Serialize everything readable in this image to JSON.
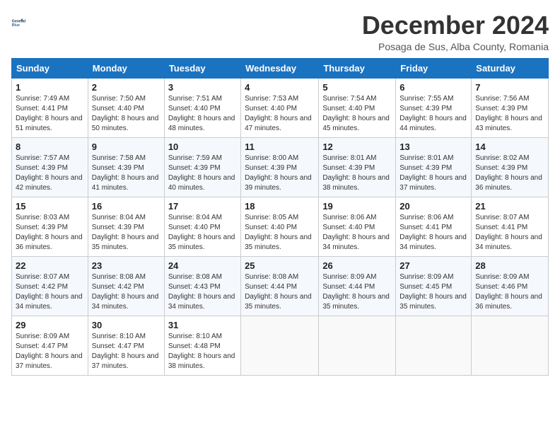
{
  "logo": {
    "line1": "General",
    "line2": "Blue"
  },
  "title": "December 2024",
  "subtitle": "Posaga de Sus, Alba County, Romania",
  "days_of_week": [
    "Sunday",
    "Monday",
    "Tuesday",
    "Wednesday",
    "Thursday",
    "Friday",
    "Saturday"
  ],
  "weeks": [
    [
      {
        "day": "1",
        "sunrise": "Sunrise: 7:49 AM",
        "sunset": "Sunset: 4:41 PM",
        "daylight": "Daylight: 8 hours and 51 minutes."
      },
      {
        "day": "2",
        "sunrise": "Sunrise: 7:50 AM",
        "sunset": "Sunset: 4:40 PM",
        "daylight": "Daylight: 8 hours and 50 minutes."
      },
      {
        "day": "3",
        "sunrise": "Sunrise: 7:51 AM",
        "sunset": "Sunset: 4:40 PM",
        "daylight": "Daylight: 8 hours and 48 minutes."
      },
      {
        "day": "4",
        "sunrise": "Sunrise: 7:53 AM",
        "sunset": "Sunset: 4:40 PM",
        "daylight": "Daylight: 8 hours and 47 minutes."
      },
      {
        "day": "5",
        "sunrise": "Sunrise: 7:54 AM",
        "sunset": "Sunset: 4:40 PM",
        "daylight": "Daylight: 8 hours and 45 minutes."
      },
      {
        "day": "6",
        "sunrise": "Sunrise: 7:55 AM",
        "sunset": "Sunset: 4:39 PM",
        "daylight": "Daylight: 8 hours and 44 minutes."
      },
      {
        "day": "7",
        "sunrise": "Sunrise: 7:56 AM",
        "sunset": "Sunset: 4:39 PM",
        "daylight": "Daylight: 8 hours and 43 minutes."
      }
    ],
    [
      {
        "day": "8",
        "sunrise": "Sunrise: 7:57 AM",
        "sunset": "Sunset: 4:39 PM",
        "daylight": "Daylight: 8 hours and 42 minutes."
      },
      {
        "day": "9",
        "sunrise": "Sunrise: 7:58 AM",
        "sunset": "Sunset: 4:39 PM",
        "daylight": "Daylight: 8 hours and 41 minutes."
      },
      {
        "day": "10",
        "sunrise": "Sunrise: 7:59 AM",
        "sunset": "Sunset: 4:39 PM",
        "daylight": "Daylight: 8 hours and 40 minutes."
      },
      {
        "day": "11",
        "sunrise": "Sunrise: 8:00 AM",
        "sunset": "Sunset: 4:39 PM",
        "daylight": "Daylight: 8 hours and 39 minutes."
      },
      {
        "day": "12",
        "sunrise": "Sunrise: 8:01 AM",
        "sunset": "Sunset: 4:39 PM",
        "daylight": "Daylight: 8 hours and 38 minutes."
      },
      {
        "day": "13",
        "sunrise": "Sunrise: 8:01 AM",
        "sunset": "Sunset: 4:39 PM",
        "daylight": "Daylight: 8 hours and 37 minutes."
      },
      {
        "day": "14",
        "sunrise": "Sunrise: 8:02 AM",
        "sunset": "Sunset: 4:39 PM",
        "daylight": "Daylight: 8 hours and 36 minutes."
      }
    ],
    [
      {
        "day": "15",
        "sunrise": "Sunrise: 8:03 AM",
        "sunset": "Sunset: 4:39 PM",
        "daylight": "Daylight: 8 hours and 36 minutes."
      },
      {
        "day": "16",
        "sunrise": "Sunrise: 8:04 AM",
        "sunset": "Sunset: 4:39 PM",
        "daylight": "Daylight: 8 hours and 35 minutes."
      },
      {
        "day": "17",
        "sunrise": "Sunrise: 8:04 AM",
        "sunset": "Sunset: 4:40 PM",
        "daylight": "Daylight: 8 hours and 35 minutes."
      },
      {
        "day": "18",
        "sunrise": "Sunrise: 8:05 AM",
        "sunset": "Sunset: 4:40 PM",
        "daylight": "Daylight: 8 hours and 35 minutes."
      },
      {
        "day": "19",
        "sunrise": "Sunrise: 8:06 AM",
        "sunset": "Sunset: 4:40 PM",
        "daylight": "Daylight: 8 hours and 34 minutes."
      },
      {
        "day": "20",
        "sunrise": "Sunrise: 8:06 AM",
        "sunset": "Sunset: 4:41 PM",
        "daylight": "Daylight: 8 hours and 34 minutes."
      },
      {
        "day": "21",
        "sunrise": "Sunrise: 8:07 AM",
        "sunset": "Sunset: 4:41 PM",
        "daylight": "Daylight: 8 hours and 34 minutes."
      }
    ],
    [
      {
        "day": "22",
        "sunrise": "Sunrise: 8:07 AM",
        "sunset": "Sunset: 4:42 PM",
        "daylight": "Daylight: 8 hours and 34 minutes."
      },
      {
        "day": "23",
        "sunrise": "Sunrise: 8:08 AM",
        "sunset": "Sunset: 4:42 PM",
        "daylight": "Daylight: 8 hours and 34 minutes."
      },
      {
        "day": "24",
        "sunrise": "Sunrise: 8:08 AM",
        "sunset": "Sunset: 4:43 PM",
        "daylight": "Daylight: 8 hours and 34 minutes."
      },
      {
        "day": "25",
        "sunrise": "Sunrise: 8:08 AM",
        "sunset": "Sunset: 4:44 PM",
        "daylight": "Daylight: 8 hours and 35 minutes."
      },
      {
        "day": "26",
        "sunrise": "Sunrise: 8:09 AM",
        "sunset": "Sunset: 4:44 PM",
        "daylight": "Daylight: 8 hours and 35 minutes."
      },
      {
        "day": "27",
        "sunrise": "Sunrise: 8:09 AM",
        "sunset": "Sunset: 4:45 PM",
        "daylight": "Daylight: 8 hours and 35 minutes."
      },
      {
        "day": "28",
        "sunrise": "Sunrise: 8:09 AM",
        "sunset": "Sunset: 4:46 PM",
        "daylight": "Daylight: 8 hours and 36 minutes."
      }
    ],
    [
      {
        "day": "29",
        "sunrise": "Sunrise: 8:09 AM",
        "sunset": "Sunset: 4:47 PM",
        "daylight": "Daylight: 8 hours and 37 minutes."
      },
      {
        "day": "30",
        "sunrise": "Sunrise: 8:10 AM",
        "sunset": "Sunset: 4:47 PM",
        "daylight": "Daylight: 8 hours and 37 minutes."
      },
      {
        "day": "31",
        "sunrise": "Sunrise: 8:10 AM",
        "sunset": "Sunset: 4:48 PM",
        "daylight": "Daylight: 8 hours and 38 minutes."
      },
      null,
      null,
      null,
      null
    ]
  ]
}
